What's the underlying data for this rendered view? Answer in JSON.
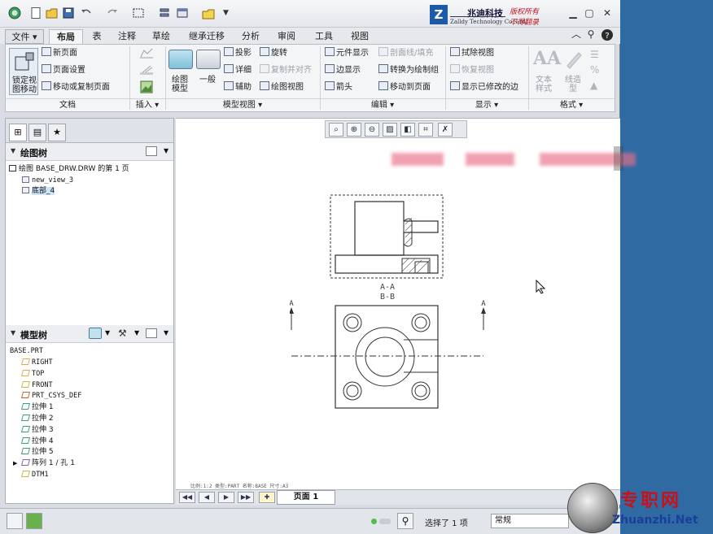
{
  "header": {
    "logo_letter": "Z",
    "company_name": "兆迪科技",
    "company_en": "Zalldy Technology Co.,Ltd.",
    "slogan_1": "版权所有",
    "slogan_2": "不得翻录",
    "window_controls": [
      "minimize-icon",
      "restore-icon",
      "close-icon"
    ]
  },
  "menu": {
    "file": "文件",
    "tabs": [
      "布局",
      "表",
      "注释",
      "草绘",
      "继承迁移",
      "分析",
      "审阅",
      "工具",
      "视图"
    ],
    "active_tab": "布局"
  },
  "ribbon": {
    "doc": {
      "lock_label_1": "锁定视",
      "lock_label_2": "图移动",
      "new_page": "新页面",
      "page_setup": "页面设置",
      "move_copy_page": "移动或复制页面",
      "group": "文档"
    },
    "insert": {
      "group": "插入"
    },
    "model_view": {
      "drawing_model_1": "绘图",
      "drawing_model_2": "模型",
      "general": "一般",
      "projection": "投影",
      "detail": "详细",
      "auxiliary": "辅助",
      "revolve": "旋转",
      "copy_align": "复制并对齐",
      "drawing_view": "绘图视图",
      "group": "模型视图"
    },
    "edit": {
      "element_display": "元件显示",
      "edge_display": "边显示",
      "arrow": "箭头",
      "hatch_fill": "剖面线/填充",
      "convert_draw_group": "转换为绘制组",
      "move_to_page": "移动到页面",
      "group": "编辑"
    },
    "display": {
      "erase_view": "拭除视图",
      "resume_view": "恢复视图",
      "show_modified_edges": "显示已修改的边",
      "group": "显示"
    },
    "format": {
      "text_style_1": "文本",
      "text_style_2": "样式",
      "line_style_1": "线造",
      "line_style_2": "型",
      "group": "格式"
    }
  },
  "drawing_tree": {
    "title": "绘图树",
    "root": "绘图 BASE_DRW.DRW 的第 1 页",
    "items": [
      "new_view_3",
      "底部_4"
    ]
  },
  "model_tree": {
    "title": "模型树",
    "root": "BASE.PRT",
    "items": [
      "RIGHT",
      "TOP",
      "FRONT",
      "PRT_CSYS_DEF",
      "拉伸 1",
      "拉伸 2",
      "拉伸 3",
      "拉伸 4",
      "拉伸 5",
      "阵列 1 / 孔 1",
      "DTM1"
    ]
  },
  "drawing": {
    "section_label_1": "A-A",
    "section_label_2": "B-B",
    "cut_label_left": "A",
    "cut_label_right": "A",
    "status_line": "比例:1:2    类型:PART    名称:BASE    尺寸:A3"
  },
  "page_bar": {
    "page_tab": "页面 1"
  },
  "status": {
    "selection": "选择了 1 项",
    "filter": "常规"
  },
  "watermark": {
    "cn": "专职网",
    "en": "Zhuanzhi.Net"
  }
}
